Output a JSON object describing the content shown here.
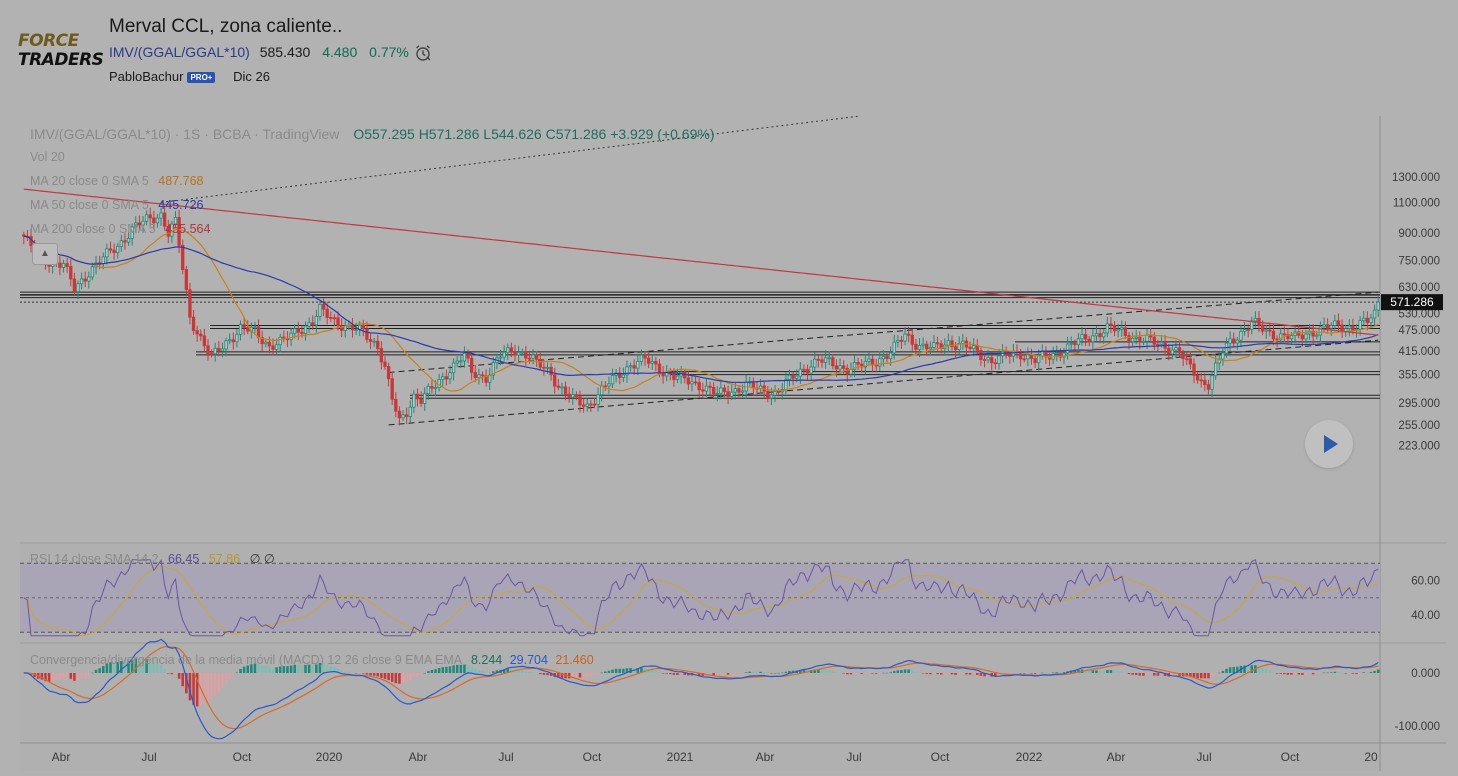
{
  "header": {
    "logo_line1": "FORCE",
    "logo_line2": "TRADERS",
    "title": "Merval CCL, zona caliente..",
    "symbol": "IMV/(GGAL/GGAL*10)",
    "price": "585.430",
    "change": "4.480",
    "change_pct": "0.77%",
    "author": "PabloBachur",
    "author_badge": "PRO+",
    "date": "Dic 26"
  },
  "legend": {
    "title": "IMV/(GGAL/GGAL*10) · 1S · BCBA · TradingView",
    "ohlc": "O557.295 H571.286 L544.626 C571.286 +3.929 (+0.69%)",
    "vol": "Vol 20",
    "ma20_label": "MA 20 close 0 SMA 5",
    "ma20_value": "487.768",
    "ma50_label": "MA 50 close 0 SMA 5",
    "ma50_value": "445.726",
    "ma200_label": "MA 200 close 0 SMA 5",
    "ma200_value": "455.564",
    "rsi_label": "RSI 14 close SMA 14 2",
    "rsi_value": "66.45",
    "rsi_sma": "57.86",
    "rsi_extra": "∅ ∅",
    "macd_label": "Convergencia/divergencia de la media móvil (MACD) 12 26 close 9 EMA EMA",
    "macd_hist": "8.244",
    "macd_line": "29.704",
    "macd_signal": "21.460"
  },
  "colors": {
    "up": "#1f8a7a",
    "down": "#c6393b",
    "ma20": "#c7801e",
    "ma50": "#2a3aa8",
    "ma200": "#c0383f",
    "rsi": "#6b55a5",
    "rsi_sma": "#c9a92c",
    "macd_line": "#2a58c8",
    "macd_signal": "#d8692a"
  },
  "icons": {
    "alarm": "alarm-clock-icon",
    "play": "play-icon",
    "collapse": "chevron-up-icon"
  },
  "chart_data": [
    {
      "type": "candlestick",
      "title": "Merval CCL, zona caliente..",
      "y_axis_ticks": [
        "1300.000",
        "1100.000",
        "900.000",
        "750.000",
        "630.000",
        "530.000",
        "475.000",
        "415.000",
        "355.000",
        "295.000",
        "255.000",
        "223.000"
      ],
      "x_axis_ticks": [
        "Abr",
        "Jul",
        "Oct",
        "2020",
        "Abr",
        "Jul",
        "Oct",
        "2021",
        "Abr",
        "Jul",
        "Oct",
        "2022",
        "Abr",
        "Jul",
        "Oct",
        "20"
      ],
      "last_price_label": "571.286",
      "log_scale": true,
      "anchors": [
        [
          0,
          880
        ],
        [
          4,
          760
        ],
        [
          8,
          745
        ],
        [
          11,
          730
        ],
        [
          14,
          620
        ],
        [
          18,
          700
        ],
        [
          22,
          760
        ],
        [
          26,
          830
        ],
        [
          30,
          920
        ],
        [
          34,
          980
        ],
        [
          38,
          1020
        ],
        [
          40,
          900
        ],
        [
          42,
          960
        ],
        [
          43,
          830
        ],
        [
          46,
          520
        ],
        [
          50,
          430
        ],
        [
          52,
          395
        ],
        [
          56,
          440
        ],
        [
          60,
          480
        ],
        [
          64,
          470
        ],
        [
          68,
          430
        ],
        [
          72,
          440
        ],
        [
          76,
          480
        ],
        [
          80,
          500
        ],
        [
          82,
          540
        ],
        [
          86,
          510
        ],
        [
          90,
          480
        ],
        [
          94,
          470
        ],
        [
          98,
          430
        ],
        [
          100,
          370
        ],
        [
          102,
          300
        ],
        [
          104,
          260
        ],
        [
          106,
          280
        ],
        [
          108,
          310
        ],
        [
          110,
          300
        ],
        [
          114,
          330
        ],
        [
          118,
          370
        ],
        [
          122,
          400
        ],
        [
          124,
          360
        ],
        [
          128,
          350
        ],
        [
          132,
          400
        ],
        [
          136,
          420
        ],
        [
          140,
          400
        ],
        [
          142,
          380
        ],
        [
          146,
          360
        ],
        [
          148,
          330
        ],
        [
          152,
          300
        ],
        [
          156,
          290
        ],
        [
          160,
          320
        ],
        [
          164,
          350
        ],
        [
          168,
          380
        ],
        [
          172,
          390
        ],
        [
          176,
          370
        ],
        [
          180,
          350
        ],
        [
          184,
          340
        ],
        [
          188,
          330
        ],
        [
          192,
          310
        ],
        [
          196,
          320
        ],
        [
          200,
          330
        ],
        [
          204,
          320
        ],
        [
          208,
          315
        ],
        [
          212,
          340
        ],
        [
          216,
          370
        ],
        [
          220,
          390
        ],
        [
          224,
          380
        ],
        [
          228,
          370
        ],
        [
          232,
          375
        ],
        [
          236,
          390
        ],
        [
          240,
          410
        ],
        [
          244,
          460
        ],
        [
          248,
          430
        ],
        [
          252,
          420
        ],
        [
          256,
          440
        ],
        [
          260,
          430
        ],
        [
          264,
          410
        ],
        [
          268,
          390
        ],
        [
          272,
          400
        ],
        [
          276,
          410
        ],
        [
          280,
          390
        ],
        [
          284,
          400
        ],
        [
          288,
          420
        ],
        [
          292,
          440
        ],
        [
          296,
          460
        ],
        [
          300,
          480
        ],
        [
          304,
          470
        ],
        [
          308,
          450
        ],
        [
          312,
          440
        ],
        [
          316,
          430
        ],
        [
          320,
          410
        ],
        [
          322,
          380
        ],
        [
          324,
          360
        ],
        [
          326,
          340
        ],
        [
          328,
          335
        ],
        [
          330,
          370
        ],
        [
          332,
          410
        ],
        [
          334,
          440
        ],
        [
          336,
          460
        ],
        [
          338,
          480
        ],
        [
          340,
          500
        ],
        [
          344,
          470
        ],
        [
          348,
          460
        ],
        [
          352,
          450
        ],
        [
          356,
          470
        ],
        [
          360,
          480
        ],
        [
          364,
          490
        ],
        [
          368,
          485
        ],
        [
          372,
          500
        ],
        [
          374,
          530
        ],
        [
          375,
          571
        ]
      ],
      "moving_averages": [
        {
          "name": "MA 20",
          "last": 487.768
        },
        {
          "name": "MA 50",
          "last": 445.726
        },
        {
          "name": "MA 200",
          "last": 455.564
        }
      ],
      "horizontal_levels": [
        610,
        600,
        490,
        412,
        362,
        310
      ],
      "channel": {
        "lower": [
          [
            101,
            255
          ],
          [
            375,
            445
          ]
        ],
        "upper": [
          [
            101,
            360
          ],
          [
            375,
            610
          ]
        ]
      }
    },
    {
      "type": "line",
      "title": "RSI 14 close SMA 14 2",
      "y_axis_ticks": [
        "60.00",
        "40.00"
      ],
      "last_value": 66.45,
      "last_sma": 57.86
    },
    {
      "type": "bar",
      "title": "MACD 12 26 close 9 EMA EMA",
      "y_axis_ticks": [
        "0.000",
        "-100.000"
      ],
      "last_histogram": 8.244,
      "last_macd": 29.704,
      "last_signal": 21.46
    }
  ]
}
